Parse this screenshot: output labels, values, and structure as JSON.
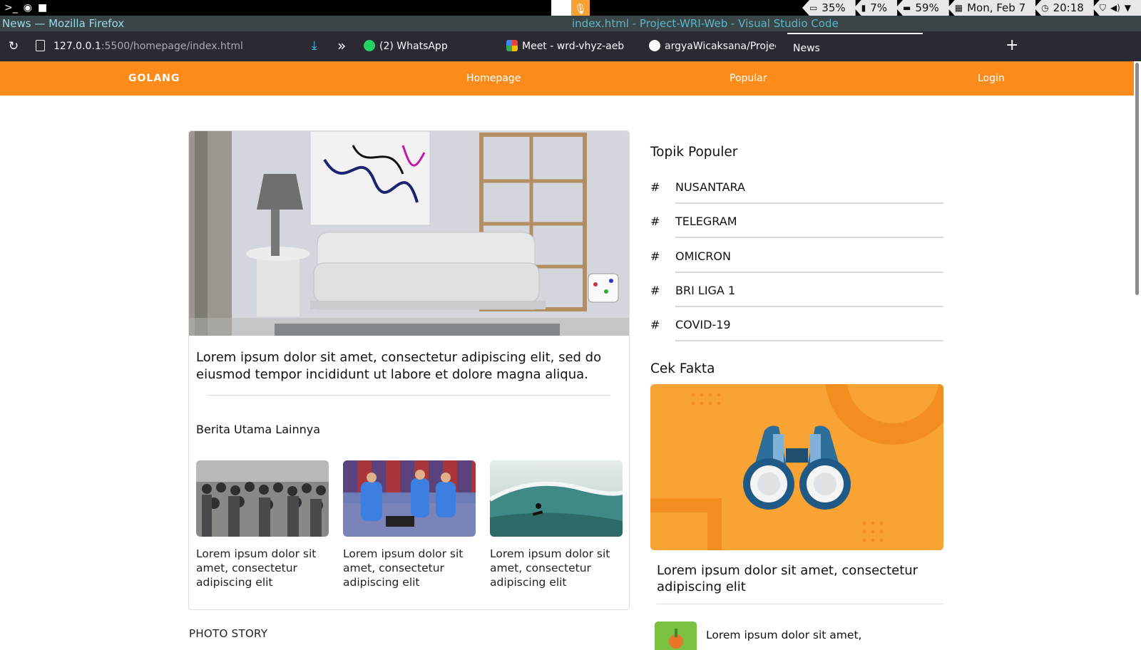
{
  "os": {
    "battery": "35%",
    "cpu": "7%",
    "memory": "59%",
    "date": "Mon, Feb  7",
    "time": "20:18"
  },
  "window": {
    "title_left": "News — Mozilla Firefox",
    "title_right": "index.html - Project-WRI-Web - Visual Studio Code"
  },
  "browser": {
    "url_host": "127.0.0.1",
    "url_path": ":5500/homepage/index.html",
    "tabs": [
      {
        "label": "(2) WhatsApp"
      },
      {
        "label": "Meet - wrd-vhyz-aeb"
      },
      {
        "label": "argyaWicaksana/Project-W"
      },
      {
        "label": "News"
      }
    ]
  },
  "nav": {
    "brand": "GOLANG",
    "links": [
      "Homepage",
      "Popular",
      "Login"
    ]
  },
  "main": {
    "hero_title": "Lorem ipsum dolor sit amet, consectetur adipiscing elit, sed do eiusmod tempor incididunt ut labore et dolore magna aliqua.",
    "more_heading": "Berita Utama Lainnya",
    "thumbs": [
      {
        "text": "Lorem ipsum dolor sit amet, consectetur adipiscing elit"
      },
      {
        "text": "Lorem ipsum dolor sit amet, consectetur adipiscing elit"
      },
      {
        "text": "Lorem ipsum dolor sit amet, consectetur adipiscing elit"
      }
    ],
    "photo_story": "PHOTO STORY"
  },
  "sidebar": {
    "topik_title": "Topik Populer",
    "hash": "#",
    "topics": [
      "NUSANTARA",
      "TELEGRAM",
      "OMICRON",
      "BRI LIGA 1",
      "COVID-19"
    ],
    "cek_title": "Cek Fakta",
    "fakta_title": "Lorem ipsum dolor sit amet, consectetur adipiscing elit",
    "small_title": "Lorem ipsum dolor sit amet,"
  },
  "colors": {
    "nav_orange": "#fb8c1c",
    "fakta_orange": "#f8a333"
  }
}
